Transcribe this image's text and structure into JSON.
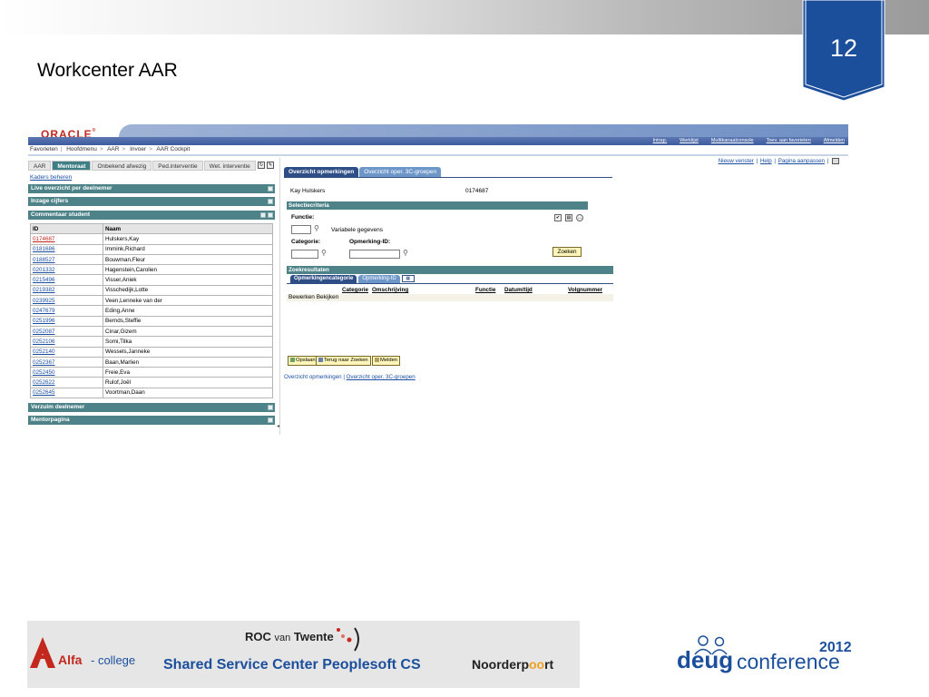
{
  "slide": {
    "title": "Workcenter AAR",
    "page_number": "12",
    "accent_color": "#1b4f9c"
  },
  "app": {
    "brand": "ORACLE",
    "top_links": [
      "Intrap.",
      "Werklijst",
      "Multikanaalconsole",
      "Toev. aan favorieten",
      "Afmelden"
    ],
    "breadcrumb": [
      "Favorieten",
      "Hoofdmenu",
      "AAR",
      "Invoer",
      "AAR Cockpit"
    ]
  },
  "left": {
    "tabs": [
      "AAR",
      "Mentoraat",
      "Onbekend afwezig",
      "Ped.interventie",
      "Wet. interventie"
    ],
    "active_tab": "Mentoraat",
    "kaders_link": "Kaders beheren",
    "sections": [
      "Live overzicht per deelnemer",
      "Inzage cijfers",
      "Commentaar student",
      "Verzuim deelnemer",
      "Mentorpagina"
    ],
    "table": {
      "headers": [
        "ID",
        "Naam"
      ],
      "rows": [
        [
          "0174687",
          "Hulskers,Kay"
        ],
        [
          "0181686",
          "Immink,Richard"
        ],
        [
          "0188527",
          "Bouwman,Fleur"
        ],
        [
          "0201332",
          "Hagenstein,Carolien"
        ],
        [
          "0215496",
          "Visser,Aniek"
        ],
        [
          "0219382",
          "Visschedijk,Lotte"
        ],
        [
          "0239925",
          "Veen,Lenneke van der"
        ],
        [
          "0247679",
          "Eding,Anne"
        ],
        [
          "0251996",
          "Bernds,Steffie"
        ],
        [
          "0252087",
          "Cinar,Gizem"
        ],
        [
          "0252106",
          "Somi,Tilka"
        ],
        [
          "0252140",
          "Wessels,Janneke"
        ],
        [
          "0252367",
          "Baan,Marlien"
        ],
        [
          "0252450",
          "Freie,Eva"
        ],
        [
          "0252622",
          "Rulof,Joël"
        ],
        [
          "0252645",
          "Voortman,Daan"
        ]
      ]
    }
  },
  "right": {
    "links": [
      "Nieuw venster",
      "Help",
      "Pagina aanpassen"
    ],
    "tabs": [
      "Overzicht opmerkingen",
      "Overzicht oper. 3C-groepen"
    ],
    "student_name": "Kay Hulskers",
    "student_id": "0174687",
    "selectiecriteria": "Selectiecriteria",
    "functie_label": "Functie:",
    "variabele_label": "Variabele gegevens",
    "categorie_label": "Categorie:",
    "opmerking_id_label": "Opmerking-ID:",
    "zoeken_button": "Zoeken",
    "zoekresultaten": "Zoekresultaten",
    "subtabs": [
      "Opmerkingencategorie",
      "Opmerking-ID"
    ],
    "columns": [
      "Categorie",
      "Omschrijving",
      "Functie",
      "Datum/tijd",
      "Volgnummer"
    ],
    "row_label": "Bewerken Bekijken",
    "buttons": [
      "Opslaan",
      "Terug naar Zoeken",
      "Melden"
    ],
    "bottom_link_plain": "Overzicht opmerkingen",
    "bottom_link": "Overzicht oper. 3C-groepen"
  },
  "footer": {
    "alfa_name": "Alfa",
    "alfa_sub": "- college",
    "roc_pre": "ROC",
    "roc_van": "van",
    "roc_post": "Twente",
    "ssc": "Shared Service Center Peoplesoft CS",
    "noorder_pre": "Noorderp",
    "noorder_oo": "oo",
    "noorder_post": "rt",
    "deug": "deug",
    "conference": "conference",
    "year": "2012"
  }
}
